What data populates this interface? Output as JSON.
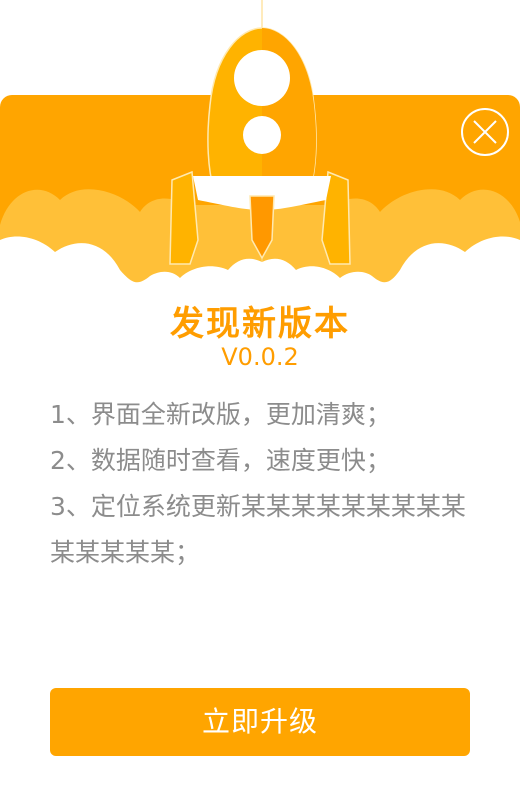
{
  "dialog": {
    "title": "发现新版本",
    "version": "V0.0.2",
    "notes": [
      "1、界面全新改版，更加清爽；",
      "2、数据随时查看，速度更快；",
      "3、定位系统更新某某某某某某某某某某某某某某；"
    ],
    "upgrade_label": "立即升级"
  },
  "icons": {
    "close": "close-icon",
    "hero": "rocket-icon"
  },
  "colors": {
    "accent": "#ffa500",
    "title": "#ff9d00",
    "note_text": "#8c8c8c",
    "cloud": "#ffc038"
  }
}
